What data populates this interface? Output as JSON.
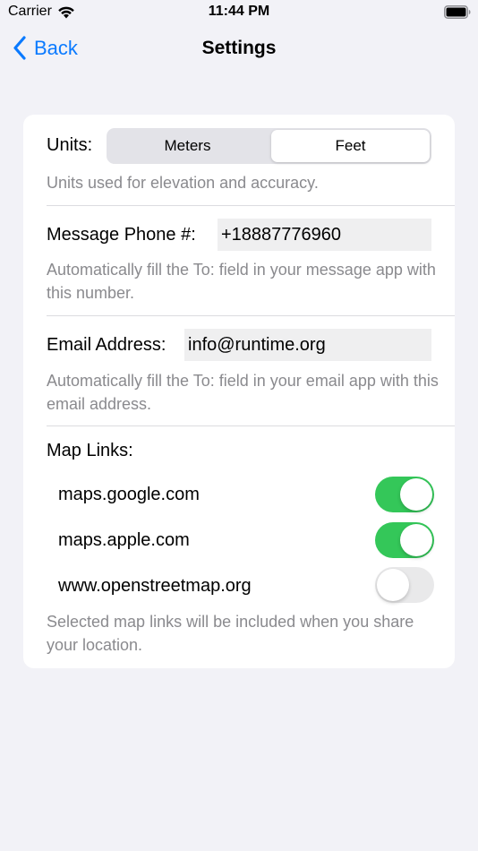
{
  "status_bar": {
    "carrier": "Carrier",
    "time": "11:44 PM"
  },
  "nav": {
    "back_label": "Back",
    "title": "Settings"
  },
  "units": {
    "label": "Units:",
    "options": [
      "Meters",
      "Feet"
    ],
    "selected": "Feet",
    "helper": "Units used for elevation and accuracy."
  },
  "phone": {
    "label": "Message Phone #:",
    "value": "+18887776960",
    "helper": "Automatically fill the To: field in your message app with this number."
  },
  "email": {
    "label": "Email Address:",
    "value": "info@runtime.org",
    "helper": "Automatically fill the To: field in your email app with this email address."
  },
  "map_links": {
    "label": "Map Links:",
    "items": [
      {
        "label": "maps.google.com",
        "enabled": true
      },
      {
        "label": "maps.apple.com",
        "enabled": true
      },
      {
        "label": "www.openstreetmap.org",
        "enabled": false
      }
    ],
    "helper": "Selected map links will be included when you share your location."
  },
  "colors": {
    "accent": "#0a7aff",
    "switch_on": "#34c759",
    "switch_off": "#e9e9ea",
    "background": "#f2f2f7"
  }
}
